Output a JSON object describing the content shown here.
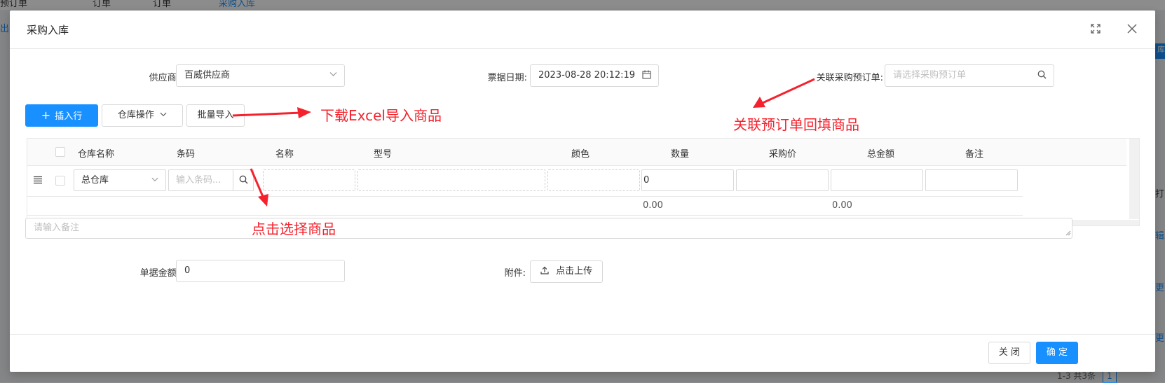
{
  "background": {
    "tabs": [
      "订单",
      "订单",
      "采购入库"
    ],
    "left_text": "预订单",
    "left_link": "出",
    "right_btn": "库",
    "right_links": [
      "打",
      "辑",
      "更",
      "更"
    ],
    "pager_text": "1-3 共3条",
    "pager_current": "1"
  },
  "modal": {
    "title": "采购入库",
    "fullscreen_icon": "fullscreen-icon",
    "close_icon": "close-icon"
  },
  "form": {
    "supplier_label": "供应商:",
    "supplier_value": "百威供应商",
    "date_label": "票据日期:",
    "date_value": "2023-08-28 20:12:19",
    "order_label": "关联采购预订单:",
    "order_placeholder": "请选择采购预订单"
  },
  "toolbar": {
    "insert_label": "插入行",
    "warehouse_op_label": "仓库操作",
    "batch_import_label": "批量导入"
  },
  "table": {
    "headers": [
      "仓库名称",
      "条码",
      "名称",
      "型号",
      "颜色",
      "数量",
      "采购价",
      "总金额",
      "备注"
    ],
    "row": {
      "warehouse": "总仓库",
      "barcode_placeholder": "输入条码...",
      "quantity": "0"
    },
    "totals": {
      "quantity": "0.00",
      "amount": "0.00"
    }
  },
  "remark_placeholder": "请输入备注",
  "bill_amount_label": "单据金额:",
  "bill_amount_value": "0",
  "attachment_label": "附件:",
  "upload_label": "点击上传",
  "footer": {
    "close_label": "关 闭",
    "confirm_label": "确 定"
  },
  "annotations": {
    "download": "下载Excel导入商品",
    "link_order": "关联预订单回填商品",
    "click_select": "点击选择商品"
  },
  "colors": {
    "primary": "#1890ff",
    "annotation": "#f5222d"
  }
}
